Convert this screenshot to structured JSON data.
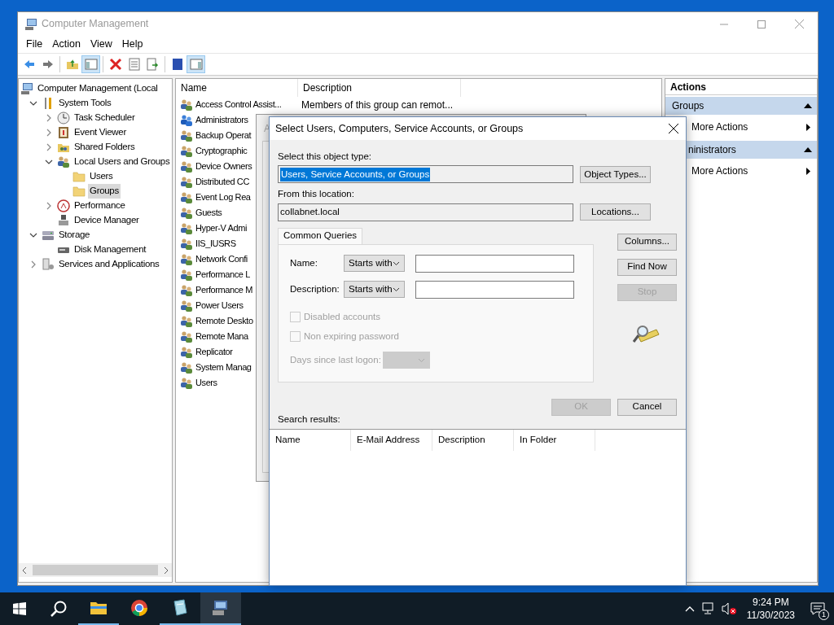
{
  "window": {
    "title": "Computer Management"
  },
  "menu": [
    "File",
    "Action",
    "View",
    "Help"
  ],
  "toolbar": [
    {
      "kind": "back",
      "pressed": false
    },
    {
      "kind": "forward",
      "pressed": false
    },
    {
      "kind": "separator"
    },
    {
      "kind": "up",
      "pressed": false
    },
    {
      "kind": "tree",
      "pressed": true
    },
    {
      "kind": "separator"
    },
    {
      "kind": "delete",
      "pressed": false
    },
    {
      "kind": "properties",
      "pressed": false
    },
    {
      "kind": "export",
      "pressed": false
    },
    {
      "kind": "separator"
    },
    {
      "kind": "help",
      "pressed": false
    },
    {
      "kind": "actionpane",
      "pressed": true
    }
  ],
  "tree": [
    {
      "label": "Computer Management (Local",
      "kind": "computer",
      "selected": false,
      "children": [
        {
          "label": "System Tools",
          "kind": "tools",
          "expanded": true,
          "selected": false,
          "children": [
            {
              "label": "Task Scheduler",
              "kind": "scheduler",
              "expanded": false,
              "selected": false
            },
            {
              "label": "Event Viewer",
              "kind": "viewer",
              "expanded": false,
              "selected": false
            },
            {
              "label": "Shared Folders",
              "kind": "shares",
              "expanded": false,
              "selected": false
            },
            {
              "label": "Local Users and Groups",
              "kind": "users",
              "expanded": true,
              "selected": false,
              "children": [
                {
                  "label": "Users",
                  "kind": "folder",
                  "selected": false
                },
                {
                  "label": "Groups",
                  "kind": "folder",
                  "selected": true
                }
              ]
            },
            {
              "label": "Performance",
              "kind": "performance",
              "expanded": false,
              "selected": false
            },
            {
              "label": "Device Manager",
              "kind": "device",
              "selected": false
            }
          ]
        },
        {
          "label": "Storage",
          "kind": "storage",
          "expanded": true,
          "selected": false,
          "children": [
            {
              "label": "Disk Management",
              "kind": "disk",
              "selected": false
            }
          ]
        },
        {
          "label": "Services and Applications",
          "kind": "services",
          "expanded": false,
          "selected": false
        }
      ]
    }
  ],
  "list": {
    "columns": [
      "Name",
      "Description"
    ],
    "rows": [
      {
        "name": "Access Control Assist...",
        "description": "Members of this group can remot...",
        "selected": false
      },
      {
        "name": "Administrators",
        "selected": true
      },
      {
        "name": "Backup Operat",
        "selected": false
      },
      {
        "name": "Cryptographic",
        "selected": false
      },
      {
        "name": "Device Owners",
        "selected": false
      },
      {
        "name": "Distributed CC",
        "selected": false
      },
      {
        "name": "Event Log Rea",
        "selected": false
      },
      {
        "name": "Guests",
        "selected": false
      },
      {
        "name": "Hyper-V Admi",
        "selected": false
      },
      {
        "name": "IIS_IUSRS",
        "selected": false
      },
      {
        "name": "Network Confi",
        "selected": false
      },
      {
        "name": "Performance L",
        "selected": false
      },
      {
        "name": "Performance M",
        "selected": false
      },
      {
        "name": "Power Users",
        "selected": false
      },
      {
        "name": "Remote Deskto",
        "selected": false
      },
      {
        "name": "Remote Mana",
        "selected": false
      },
      {
        "name": "Replicator",
        "selected": false
      },
      {
        "name": "System Manag",
        "selected": false
      },
      {
        "name": "Users",
        "selected": false
      }
    ]
  },
  "actions": {
    "header": "Actions",
    "sections": [
      {
        "title": "Groups",
        "items": [
          "More Actions"
        ]
      },
      {
        "title": "ninistrators",
        "items": [
          "More Actions"
        ]
      }
    ]
  },
  "background_window": {
    "title": "A"
  },
  "dialog": {
    "title": "Select Users, Computers, Service Accounts, or Groups",
    "object_type_label": "Select this object type:",
    "object_type": "Users, Service Accounts, or Groups",
    "object_types_button": "Object Types...",
    "location_label": "From this location:",
    "location": "collabnet.local",
    "locations_button": "Locations...",
    "tabs": [
      {
        "label": "Common Queries",
        "selected": true
      }
    ],
    "queries": [
      {
        "label": "Name:",
        "operator": "Starts with"
      },
      {
        "label": "Description:",
        "operator": "Starts with"
      }
    ],
    "checkboxes": [
      {
        "label": "Disabled accounts",
        "checked": false,
        "disabled": true
      },
      {
        "label": "Non expiring password",
        "checked": false,
        "disabled": true
      }
    ],
    "days_label": "Days since last logon:",
    "side_buttons": [
      {
        "label": "Columns...",
        "disabled": false
      },
      {
        "label": "Find Now",
        "disabled": false
      },
      {
        "label": "Stop",
        "disabled": true
      }
    ],
    "ok": {
      "label": "OK",
      "disabled": true
    },
    "cancel": {
      "label": "Cancel",
      "disabled": false
    },
    "results_label": "Search results:",
    "result_columns": [
      "Name",
      "E-Mail Address",
      "Description",
      "In Folder"
    ]
  },
  "taskbar": {
    "apps": [
      {
        "kind": "explorer",
        "running": true,
        "active": false
      },
      {
        "kind": "chrome",
        "running": false,
        "active": false
      },
      {
        "kind": "notepad",
        "running": true,
        "active": false
      },
      {
        "kind": "compmgmt",
        "running": true,
        "active": true
      }
    ],
    "time": "9:24 PM",
    "date": "11/30/2023",
    "notifications": "1"
  }
}
